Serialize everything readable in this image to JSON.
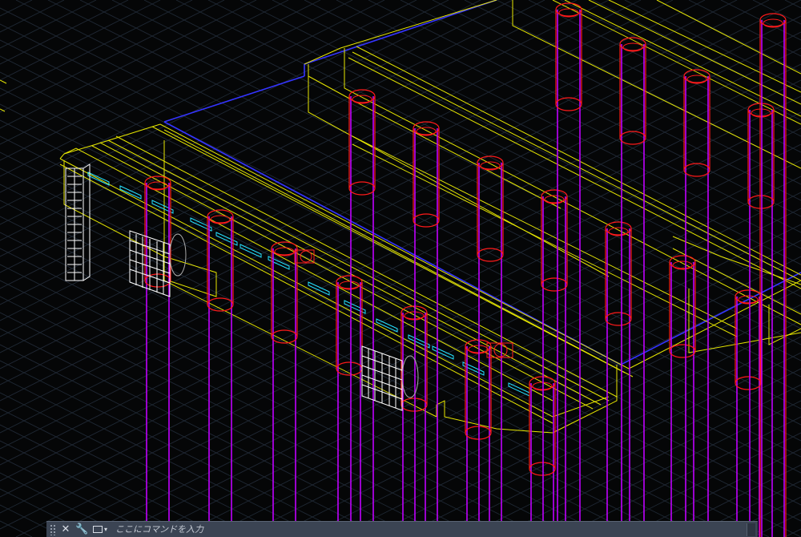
{
  "app": {
    "background": "#050607",
    "colors": {
      "grid": "#202a36",
      "structure_yellow": "#e6e600",
      "slab_edge_blue": "#3434ff",
      "pile_red": "#ff1a1a",
      "pile_magenta": "#c000ff",
      "conduit_cyan": "#26e0ff",
      "panel_white": "#ffffff"
    }
  },
  "command_line": {
    "placeholder": "ここにコマンドを入力",
    "value": "",
    "icons": {
      "grip": "drag-handle-icon",
      "close": "close-icon",
      "customize": "wrench-icon",
      "recent": "command-prompt-icon"
    },
    "glyphs": {
      "close": "✕",
      "customize": "🔧",
      "caret": "▾"
    }
  }
}
